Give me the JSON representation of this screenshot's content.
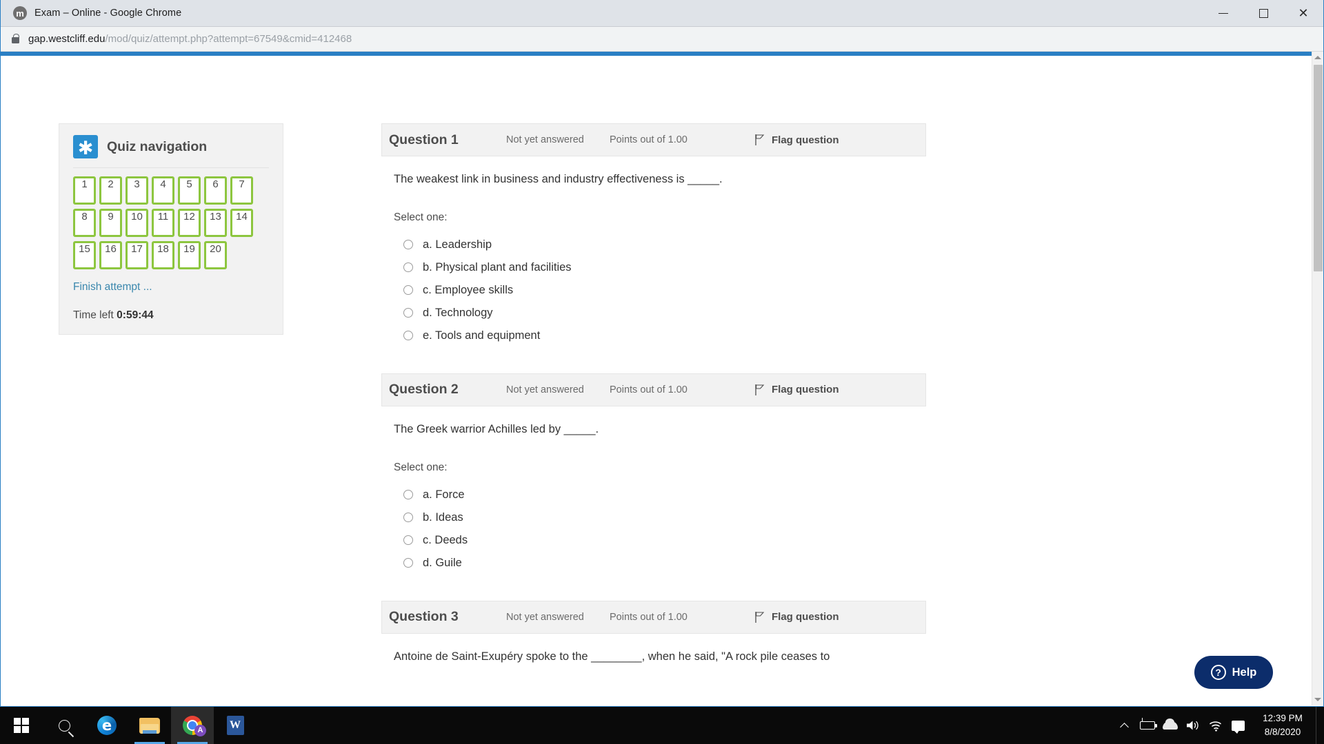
{
  "window": {
    "title": "Exam – Online - Google Chrome",
    "favicon": "moodle-icon",
    "minimize_label": "Minimize",
    "maximize_label": "Maximize",
    "close_label": "Close"
  },
  "address_bar": {
    "lock_icon": "lock-icon",
    "url_domain": "gap.westcliff.edu",
    "url_path": "/mod/quiz/attempt.php?attempt=67549&cmid=412468"
  },
  "quiz_navigation": {
    "icon": "asterisk-icon",
    "title": "Quiz navigation",
    "boxes": [
      "1",
      "2",
      "3",
      "4",
      "5",
      "6",
      "7",
      "8",
      "9",
      "10",
      "11",
      "12",
      "13",
      "14",
      "15",
      "16",
      "17",
      "18",
      "19",
      "20"
    ],
    "finish_link": "Finish attempt ...",
    "time_left_label": "Time left",
    "time_left_value": "0:59:44",
    "box_border_color": "#8dc63f",
    "accent_color": "#2a8fd0"
  },
  "questions": [
    {
      "number": "Question 1",
      "state": "Not yet answered",
      "points": "Points out of 1.00",
      "flag_label": "Flag question",
      "text": "The weakest link in business and industry effectiveness is _____.",
      "select_label": "Select one:",
      "options": [
        "a. Leadership",
        "b. Physical plant and facilities",
        "c. Employee skills",
        "d. Technology",
        "e. Tools and equipment"
      ]
    },
    {
      "number": "Question 2",
      "state": "Not yet answered",
      "points": "Points out of 1.00",
      "flag_label": "Flag question",
      "text": "The Greek warrior Achilles led by _____.",
      "select_label": "Select one:",
      "options": [
        "a. Force",
        "b. Ideas",
        "c. Deeds",
        "d. Guile"
      ]
    },
    {
      "number": "Question 3",
      "state": "Not yet answered",
      "points": "Points out of 1.00",
      "flag_label": "Flag question",
      "text": "Antoine de Saint-Exupéry spoke to the ________, when he said, \"A rock pile ceases to",
      "select_label": "",
      "options": []
    }
  ],
  "help_widget": {
    "icon": "question-circle-icon",
    "label": "Help",
    "color": "#0c2d6b"
  },
  "taskbar": {
    "items": [
      {
        "name": "start-button",
        "glyph": "windows-logo-icon"
      },
      {
        "name": "search-button",
        "glyph": "search-icon"
      },
      {
        "name": "edge-button",
        "glyph": "edge-icon",
        "letter": "e"
      },
      {
        "name": "file-explorer-button",
        "glyph": "folder-icon"
      },
      {
        "name": "chrome-button",
        "glyph": "chrome-icon",
        "badge": "A"
      },
      {
        "name": "word-button",
        "glyph": "word-icon",
        "letter": "W"
      }
    ],
    "tray": [
      {
        "name": "show-hidden-icons",
        "glyph": "chevron-up-icon"
      },
      {
        "name": "battery-icon",
        "glyph": "battery-charging-icon"
      },
      {
        "name": "onedrive-icon",
        "glyph": "cloud-icon"
      },
      {
        "name": "volume-icon",
        "glyph": "speaker-icon"
      },
      {
        "name": "network-icon",
        "glyph": "wifi-icon"
      },
      {
        "name": "action-center-icon",
        "glyph": "notification-icon"
      }
    ],
    "clock_time": "12:39 PM",
    "clock_date": "8/8/2020"
  }
}
